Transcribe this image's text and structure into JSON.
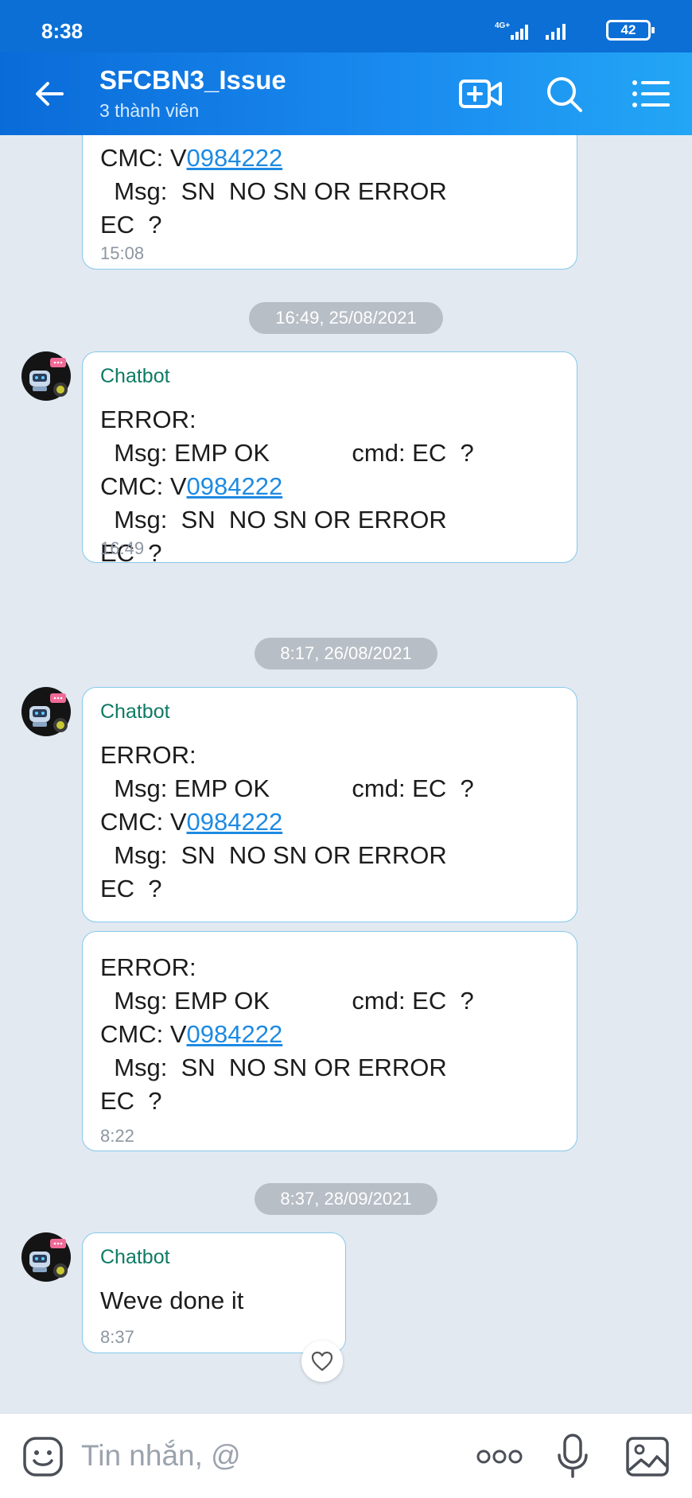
{
  "status": {
    "time": "8:38",
    "network": "4G+",
    "battery": "42"
  },
  "header": {
    "title": "SFCBN3_Issue",
    "subtitle": "3 thành viên"
  },
  "messages": {
    "m0": {
      "line1_prefix": "CMC: V",
      "line1_link": "0984222",
      "rest": "  Msg:  SN  NO SN OR ERROR\nEC  ?",
      "time": "15:08"
    },
    "d1": "16:49, 25/08/2021",
    "m1": {
      "sender": "Chatbot",
      "line1": "ERROR:\n  Msg: EMP OK            cmd: EC  ?",
      "cmc_prefix": "CMC: V",
      "cmc_link": "0984222",
      "rest": "  Msg:  SN  NO SN OR ERROR\nEC  ?",
      "time": "16:49"
    },
    "d2": "8:17, 26/08/2021",
    "m2": {
      "sender": "Chatbot",
      "line1": "ERROR:\n  Msg: EMP OK            cmd: EC  ?",
      "cmc_prefix": "CMC: V",
      "cmc_link": "0984222",
      "rest": "  Msg:  SN  NO SN OR ERROR\nEC  ?"
    },
    "m3": {
      "line1": "ERROR:\n  Msg: EMP OK            cmd: EC  ?",
      "cmc_prefix": "CMC: V",
      "cmc_link": "0984222",
      "rest": "  Msg:  SN  NO SN OR ERROR\nEC  ?",
      "time": "8:22"
    },
    "d3": "8:37, 28/09/2021",
    "m4": {
      "sender": "Chatbot",
      "text": "Weve done it",
      "time": "8:37"
    }
  },
  "composer": {
    "placeholder": "Tin nhắn, @"
  },
  "colors": {
    "accent": "#0a6bd8",
    "sender": "#0e7b64",
    "link": "#1e8ae2",
    "bubble_border": "#86c9e9"
  },
  "icons": [
    "back-arrow-icon",
    "video-call-icon",
    "search-icon",
    "menu-list-icon",
    "chatbot-avatar",
    "heart-icon",
    "emoji-icon",
    "more-icon",
    "mic-icon",
    "image-icon"
  ]
}
